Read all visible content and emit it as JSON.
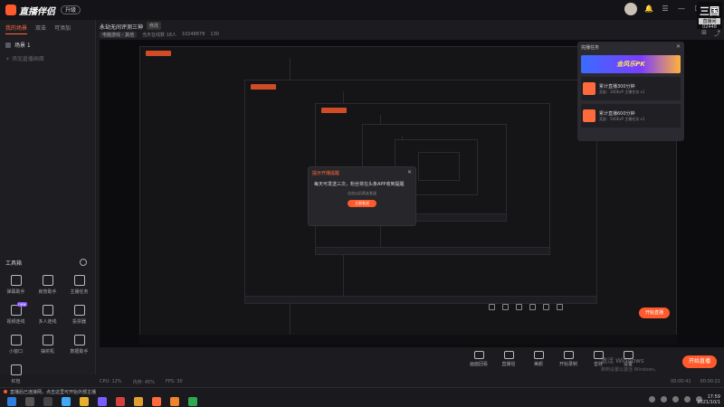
{
  "app": {
    "logo_text": "直播伴侣",
    "version": "升级"
  },
  "corner_logo": {
    "big": "三国",
    "badge": "直播间",
    "num": "02448"
  },
  "left_panel": {
    "tabs": [
      "我的场景",
      "双击",
      "可添加"
    ],
    "scene_item": "场景 1",
    "add_source": "+ 添加直播画面",
    "tools_header": "工具箱",
    "tools": [
      {
        "label": "弹幕助手",
        "icon": "danmaku-icon"
      },
      {
        "label": "房管助手",
        "icon": "shield-icon"
      },
      {
        "label": "主播任务",
        "icon": "task-icon"
      },
      {
        "label": "视频连线",
        "icon": "video-icon",
        "tag": "new"
      },
      {
        "label": "多人连线",
        "icon": "users-icon"
      },
      {
        "label": "投票器",
        "icon": "vote-icon"
      },
      {
        "label": "小窗口",
        "icon": "window-icon"
      },
      {
        "label": "抽奖机",
        "icon": "gift-icon"
      },
      {
        "label": "数据助手",
        "icon": "chart-icon"
      },
      {
        "label": "红包",
        "icon": "redpack-icon"
      }
    ]
  },
  "title_area": {
    "room_title": "永劫无间评测三神",
    "edit_tag": "修改",
    "category": "电脑游戏 - 其他",
    "meta1": "当天在线数 18人",
    "meta2": "10248678",
    "meta3": "130"
  },
  "popup": {
    "title": "完播任务",
    "banner": "金风乐PK",
    "cards": [
      {
        "title": "累计直播300分钟",
        "sub": "奖励：300ExP 主播任务 x1"
      },
      {
        "title": "累计直播600分钟",
        "sub": "奖励：500ExP 主播任务 x1"
      }
    ]
  },
  "modal": {
    "title": "提示开播提醒",
    "text": "每天可发送三次，粉丝将在头条APP收到提醒",
    "link": "点击以后再去发送",
    "button": "立即发送"
  },
  "actions": [
    {
      "label": "画面回看",
      "icon": "screen-icon"
    },
    {
      "label": "直播信",
      "icon": "mic-icon"
    },
    {
      "label": "美颜",
      "icon": "beauty-icon"
    },
    {
      "label": "开始录制",
      "icon": "record-icon"
    },
    {
      "label": "音效",
      "icon": "sound-icon"
    },
    {
      "label": "设置",
      "icon": "gear-icon"
    }
  ],
  "live_button": "开始直播",
  "watermark": {
    "line1": "激活 Windows",
    "line2": "转到设置以激活 Windows。"
  },
  "status": {
    "left": [
      "CPU: 12%",
      "内存: 45%",
      "FPS: 30"
    ],
    "right": [
      "00:00:41",
      "00:00:21"
    ]
  },
  "taskbar": {
    "notice": "直播后已连接网，点击这里可开始外部主播",
    "time": "17:59",
    "date": "2021/10/1"
  }
}
